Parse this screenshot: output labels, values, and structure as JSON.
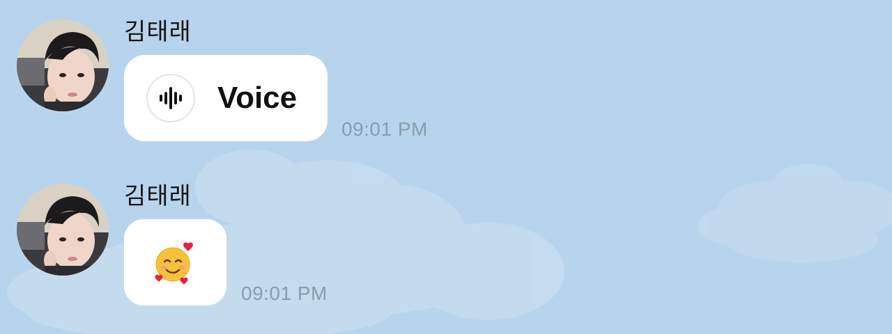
{
  "chat": {
    "background_color": "#b8d4ec",
    "bubble_color": "#ffffff",
    "messages": [
      {
        "sender": "김태래",
        "avatar_icon": "profile-photo",
        "type": "voice",
        "voice_icon": "audio-waveform-icon",
        "content": "Voice",
        "time": "09:01 PM"
      },
      {
        "sender": "김태래",
        "avatar_icon": "profile-photo",
        "type": "emoji",
        "emoji_icon": "smiling-face-with-hearts-icon",
        "emoji": "🥰",
        "time": "09:01 PM"
      }
    ]
  }
}
